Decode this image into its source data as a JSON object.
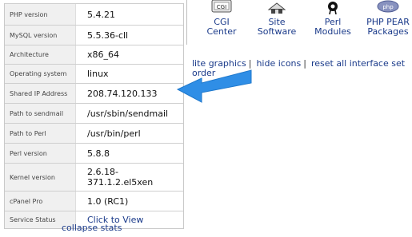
{
  "stats": [
    {
      "key": "PHP version",
      "value": "5.4.21"
    },
    {
      "key": "MySQL version",
      "value": "5.5.36-cll"
    },
    {
      "key": "Architecture",
      "value": "x86_64"
    },
    {
      "key": "Operating system",
      "value": "linux"
    },
    {
      "key": "Shared IP Address",
      "value": "208.74.120.133"
    },
    {
      "key": "Path to sendmail",
      "value": "/usr/sbin/sendmail"
    },
    {
      "key": "Path to Perl",
      "value": "/usr/bin/perl"
    },
    {
      "key": "Perl version",
      "value": "5.8.8"
    },
    {
      "key": "Kernel version",
      "value": "2.6.18-\n371.1.2.el5xen"
    },
    {
      "key": "cPanel Pro",
      "value": "1.0 (RC1)"
    },
    {
      "key": "Service Status",
      "value": "Click to View"
    }
  ],
  "collapse_label": "collapse stats",
  "icons": [
    {
      "line1": "CGI",
      "line2": "Center",
      "icon": "cgi-icon"
    },
    {
      "line1": "Site",
      "line2": "Software",
      "icon": "site-software-icon"
    },
    {
      "line1": "Perl",
      "line2": "Modules",
      "icon": "perl-icon"
    },
    {
      "line1": "PHP PEAR",
      "line2": "Packages",
      "icon": "php-icon"
    }
  ],
  "interface_links": {
    "lite": "lite graphics",
    "hide": "hide icons",
    "reset": "reset all interface set",
    "sep": "|",
    "overflow": "order"
  },
  "icon_labels": {
    "cgi_badge": "CGI",
    "php_badge": "php"
  },
  "colors": {
    "arrow": "#2f8ee6",
    "link": "#1a3a8a",
    "key_bg": "#f0f0f0"
  }
}
